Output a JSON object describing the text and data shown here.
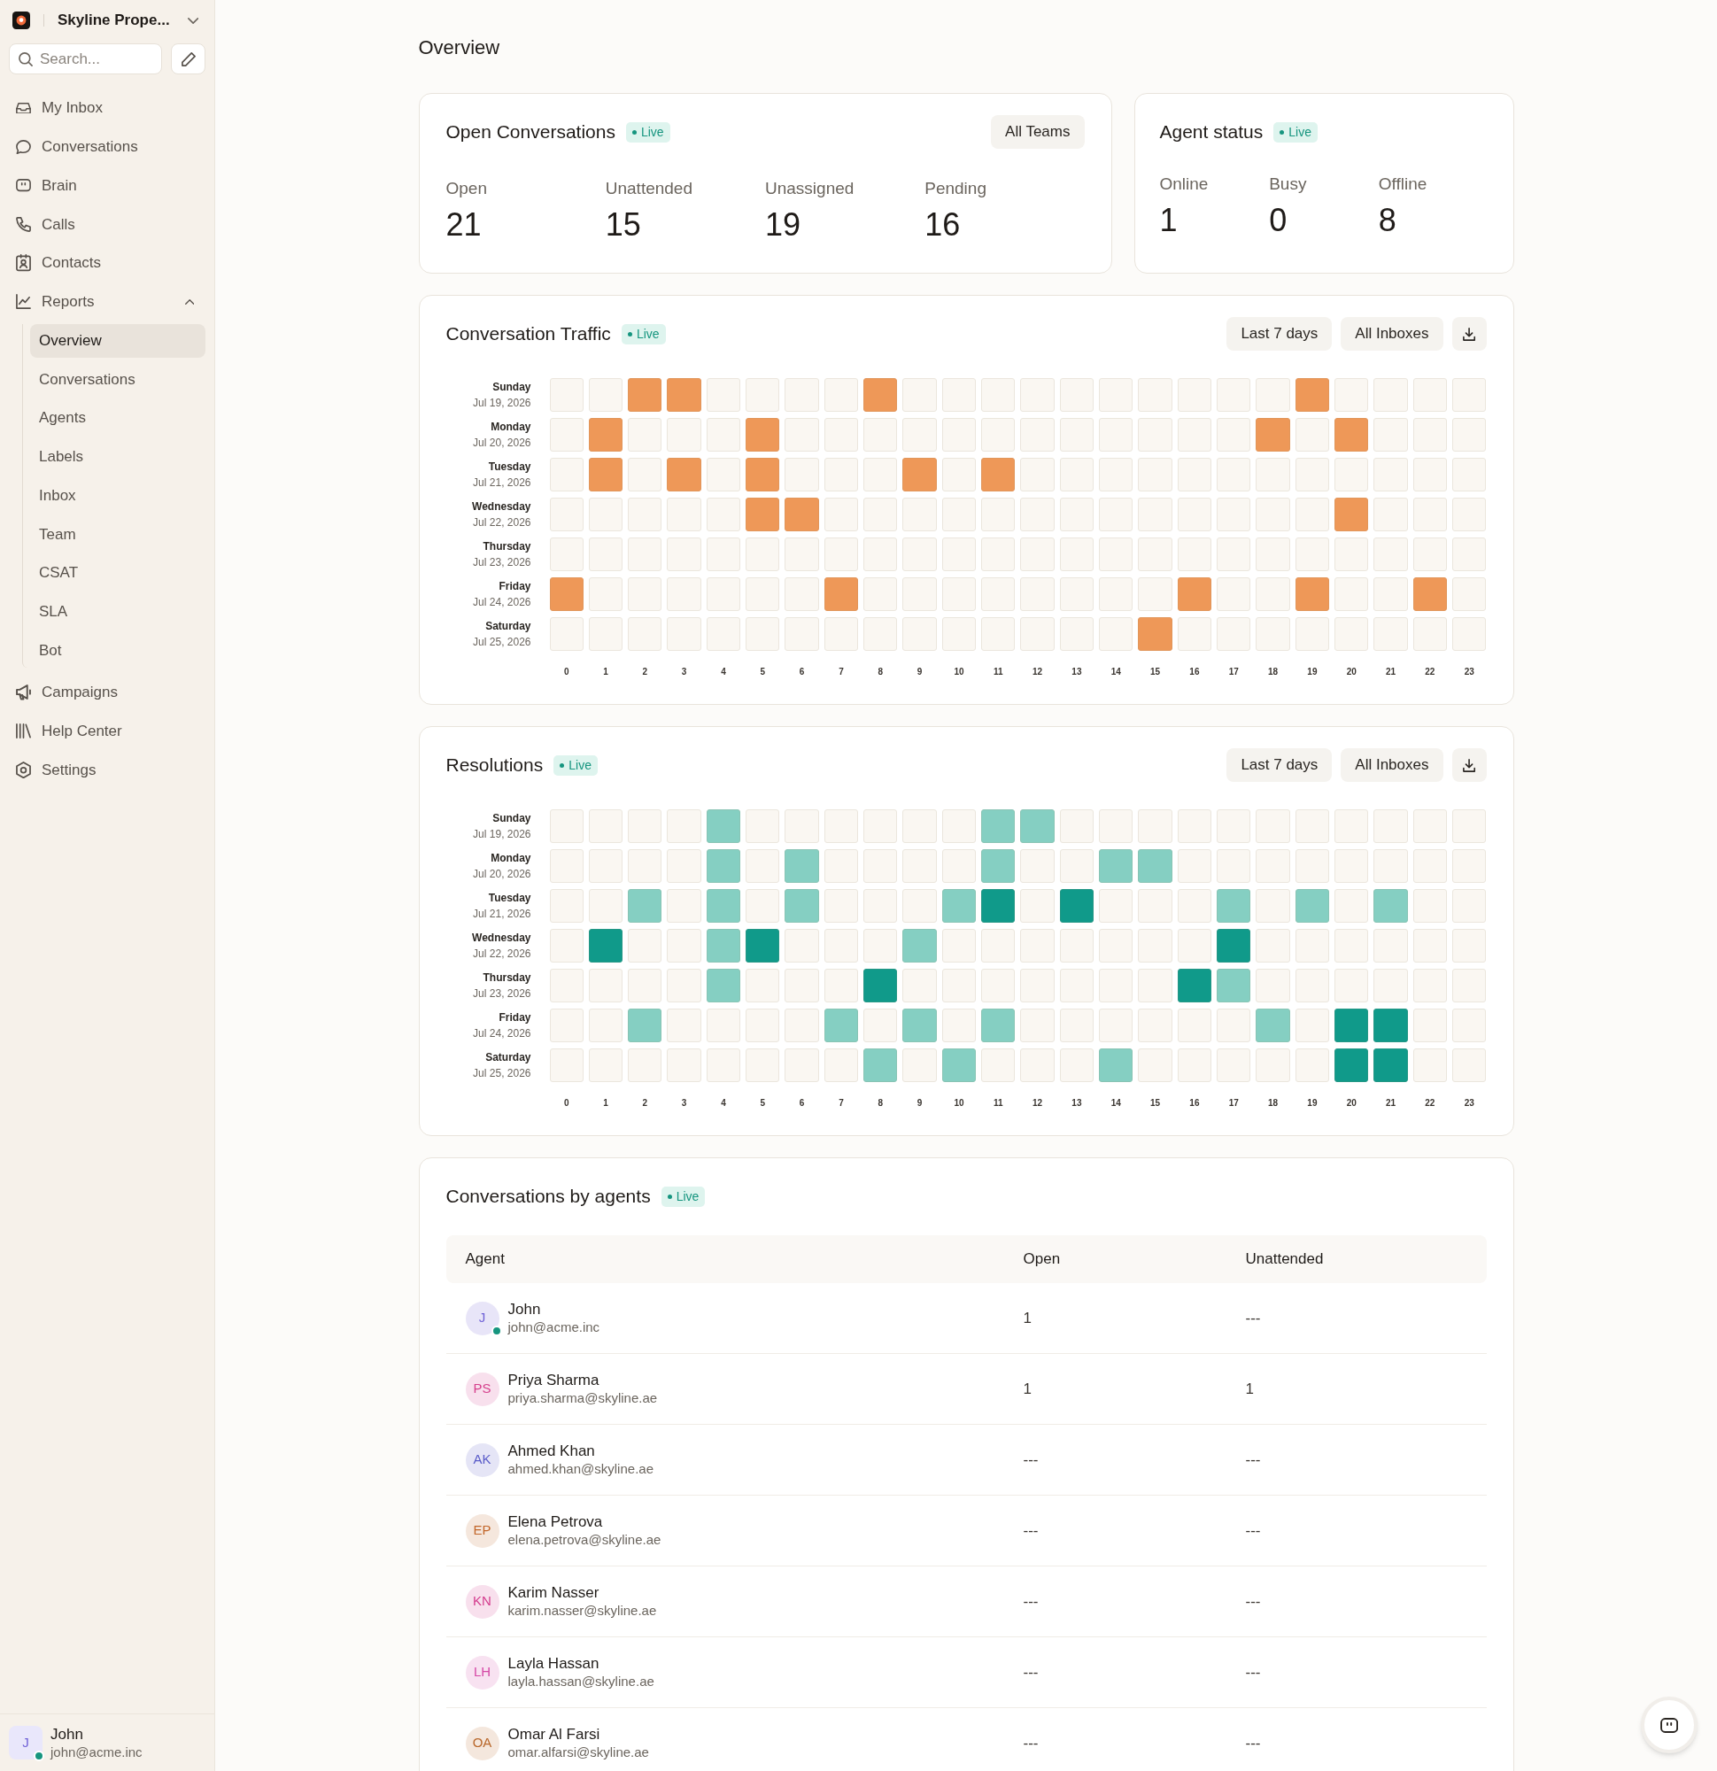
{
  "sidebar": {
    "workspace": {
      "name": "Skyline Prope..."
    },
    "search": {
      "placeholder": "Search..."
    },
    "items": [
      {
        "label": "My Inbox",
        "selected": false
      },
      {
        "label": "Conversations",
        "selected": false
      },
      {
        "label": "Brain",
        "selected": false
      },
      {
        "label": "Calls",
        "selected": false
      },
      {
        "label": "Contacts",
        "selected": false
      },
      {
        "label": "Reports",
        "selected": false,
        "expanded": true,
        "children": [
          {
            "label": "Overview",
            "selected": true
          },
          {
            "label": "Conversations",
            "selected": false
          },
          {
            "label": "Agents",
            "selected": false
          },
          {
            "label": "Labels",
            "selected": false
          },
          {
            "label": "Inbox",
            "selected": false
          },
          {
            "label": "Team",
            "selected": false
          },
          {
            "label": "CSAT",
            "selected": false
          },
          {
            "label": "SLA",
            "selected": false
          },
          {
            "label": "Bot",
            "selected": false
          }
        ]
      },
      {
        "label": "Campaigns",
        "selected": false
      },
      {
        "label": "Help Center",
        "selected": false
      },
      {
        "label": "Settings",
        "selected": false
      }
    ],
    "user": {
      "initials": "J",
      "name": "John",
      "email": "john@acme.inc",
      "online": true
    }
  },
  "page": {
    "title": "Overview"
  },
  "open_conversations": {
    "title": "Open Conversations",
    "badge": "Live",
    "filter": "All Teams",
    "stats": [
      {
        "label": "Open",
        "value": "21"
      },
      {
        "label": "Unattended",
        "value": "15"
      },
      {
        "label": "Unassigned",
        "value": "19"
      },
      {
        "label": "Pending",
        "value": "16"
      }
    ]
  },
  "agent_status": {
    "title": "Agent status",
    "badge": "Live",
    "stats": [
      {
        "label": "Online",
        "value": "1"
      },
      {
        "label": "Busy",
        "value": "0"
      },
      {
        "label": "Offline",
        "value": "8"
      }
    ]
  },
  "conversation_traffic": {
    "title": "Conversation Traffic",
    "badge": "Live",
    "filters": [
      "Last 7 days",
      "All Inboxes"
    ],
    "rows": [
      {
        "day": "Sunday",
        "date": "Jul 19, 2026",
        "cells": [
          {
            "color": "#faf7f2"
          },
          {
            "color": "#faf7f2"
          },
          {
            "color": "#ee9858"
          },
          {
            "color": "#ee9858"
          },
          {
            "color": "#faf7f2"
          },
          {
            "color": "#faf7f2"
          },
          {
            "color": "#faf7f2"
          },
          {
            "color": "#faf7f2"
          },
          {
            "color": "#ee9858"
          },
          {
            "color": "#faf7f2"
          },
          {
            "color": "#faf7f2"
          },
          {
            "color": "#faf7f2"
          },
          {
            "color": "#faf7f2"
          },
          {
            "color": "#faf7f2"
          },
          {
            "color": "#faf7f2"
          },
          {
            "color": "#faf7f2"
          },
          {
            "color": "#faf7f2"
          },
          {
            "color": "#faf7f2"
          },
          {
            "color": "#faf7f2"
          },
          {
            "color": "#ee9858"
          },
          {
            "color": "#faf7f2"
          },
          {
            "color": "#faf7f2"
          },
          {
            "color": "#faf7f2"
          },
          {
            "color": "#faf7f2"
          }
        ]
      },
      {
        "day": "Monday",
        "date": "Jul 20, 2026",
        "cells": [
          {
            "color": "#faf7f2"
          },
          {
            "color": "#ee9858"
          },
          {
            "color": "#faf7f2"
          },
          {
            "color": "#faf7f2"
          },
          {
            "color": "#faf7f2"
          },
          {
            "color": "#ee9858"
          },
          {
            "color": "#faf7f2"
          },
          {
            "color": "#faf7f2"
          },
          {
            "color": "#faf7f2"
          },
          {
            "color": "#faf7f2"
          },
          {
            "color": "#faf7f2"
          },
          {
            "color": "#faf7f2"
          },
          {
            "color": "#faf7f2"
          },
          {
            "color": "#faf7f2"
          },
          {
            "color": "#faf7f2"
          },
          {
            "color": "#faf7f2"
          },
          {
            "color": "#faf7f2"
          },
          {
            "color": "#faf7f2"
          },
          {
            "color": "#ee9858"
          },
          {
            "color": "#faf7f2"
          },
          {
            "color": "#ee9858"
          },
          {
            "color": "#faf7f2"
          },
          {
            "color": "#faf7f2"
          },
          {
            "color": "#faf7f2"
          }
        ]
      },
      {
        "day": "Tuesday",
        "date": "Jul 21, 2026",
        "cells": [
          {
            "color": "#faf7f2"
          },
          {
            "color": "#ee9858"
          },
          {
            "color": "#faf7f2"
          },
          {
            "color": "#ee9858"
          },
          {
            "color": "#faf7f2"
          },
          {
            "color": "#ee9858"
          },
          {
            "color": "#faf7f2"
          },
          {
            "color": "#faf7f2"
          },
          {
            "color": "#faf7f2"
          },
          {
            "color": "#ee9858"
          },
          {
            "color": "#faf7f2"
          },
          {
            "color": "#ee9858"
          },
          {
            "color": "#faf7f2"
          },
          {
            "color": "#faf7f2"
          },
          {
            "color": "#faf7f2"
          },
          {
            "color": "#faf7f2"
          },
          {
            "color": "#faf7f2"
          },
          {
            "color": "#faf7f2"
          },
          {
            "color": "#faf7f2"
          },
          {
            "color": "#faf7f2"
          },
          {
            "color": "#faf7f2"
          },
          {
            "color": "#faf7f2"
          },
          {
            "color": "#faf7f2"
          },
          {
            "color": "#faf7f2"
          }
        ]
      },
      {
        "day": "Wednesday",
        "date": "Jul 22, 2026",
        "cells": [
          {
            "color": "#faf7f2"
          },
          {
            "color": "#faf7f2"
          },
          {
            "color": "#faf7f2"
          },
          {
            "color": "#faf7f2"
          },
          {
            "color": "#faf7f2"
          },
          {
            "color": "#ee9858"
          },
          {
            "color": "#ee9858"
          },
          {
            "color": "#faf7f2"
          },
          {
            "color": "#faf7f2"
          },
          {
            "color": "#faf7f2"
          },
          {
            "color": "#faf7f2"
          },
          {
            "color": "#faf7f2"
          },
          {
            "color": "#faf7f2"
          },
          {
            "color": "#faf7f2"
          },
          {
            "color": "#faf7f2"
          },
          {
            "color": "#faf7f2"
          },
          {
            "color": "#faf7f2"
          },
          {
            "color": "#faf7f2"
          },
          {
            "color": "#faf7f2"
          },
          {
            "color": "#faf7f2"
          },
          {
            "color": "#ee9858"
          },
          {
            "color": "#faf7f2"
          },
          {
            "color": "#faf7f2"
          },
          {
            "color": "#faf7f2"
          }
        ]
      },
      {
        "day": "Thursday",
        "date": "Jul 23, 2026",
        "cells": [
          {
            "color": "#faf7f2"
          },
          {
            "color": "#faf7f2"
          },
          {
            "color": "#faf7f2"
          },
          {
            "color": "#faf7f2"
          },
          {
            "color": "#faf7f2"
          },
          {
            "color": "#faf7f2"
          },
          {
            "color": "#faf7f2"
          },
          {
            "color": "#faf7f2"
          },
          {
            "color": "#faf7f2"
          },
          {
            "color": "#faf7f2"
          },
          {
            "color": "#faf7f2"
          },
          {
            "color": "#faf7f2"
          },
          {
            "color": "#faf7f2"
          },
          {
            "color": "#faf7f2"
          },
          {
            "color": "#faf7f2"
          },
          {
            "color": "#faf7f2"
          },
          {
            "color": "#faf7f2"
          },
          {
            "color": "#faf7f2"
          },
          {
            "color": "#faf7f2"
          },
          {
            "color": "#faf7f2"
          },
          {
            "color": "#faf7f2"
          },
          {
            "color": "#faf7f2"
          },
          {
            "color": "#faf7f2"
          },
          {
            "color": "#faf7f2"
          }
        ]
      },
      {
        "day": "Friday",
        "date": "Jul 24, 2026",
        "cells": [
          {
            "color": "#ee9858"
          },
          {
            "color": "#faf7f2"
          },
          {
            "color": "#faf7f2"
          },
          {
            "color": "#faf7f2"
          },
          {
            "color": "#faf7f2"
          },
          {
            "color": "#faf7f2"
          },
          {
            "color": "#faf7f2"
          },
          {
            "color": "#ee9858"
          },
          {
            "color": "#faf7f2"
          },
          {
            "color": "#faf7f2"
          },
          {
            "color": "#faf7f2"
          },
          {
            "color": "#faf7f2"
          },
          {
            "color": "#faf7f2"
          },
          {
            "color": "#faf7f2"
          },
          {
            "color": "#faf7f2"
          },
          {
            "color": "#faf7f2"
          },
          {
            "color": "#ee9858"
          },
          {
            "color": "#faf7f2"
          },
          {
            "color": "#faf7f2"
          },
          {
            "color": "#ee9858"
          },
          {
            "color": "#faf7f2"
          },
          {
            "color": "#faf7f2"
          },
          {
            "color": "#ee9858"
          },
          {
            "color": "#faf7f2"
          }
        ]
      },
      {
        "day": "Saturday",
        "date": "Jul 25, 2026",
        "cells": [
          {
            "color": "#faf7f2"
          },
          {
            "color": "#faf7f2"
          },
          {
            "color": "#faf7f2"
          },
          {
            "color": "#faf7f2"
          },
          {
            "color": "#faf7f2"
          },
          {
            "color": "#faf7f2"
          },
          {
            "color": "#faf7f2"
          },
          {
            "color": "#faf7f2"
          },
          {
            "color": "#faf7f2"
          },
          {
            "color": "#faf7f2"
          },
          {
            "color": "#faf7f2"
          },
          {
            "color": "#faf7f2"
          },
          {
            "color": "#faf7f2"
          },
          {
            "color": "#faf7f2"
          },
          {
            "color": "#faf7f2"
          },
          {
            "color": "#ee9858"
          },
          {
            "color": "#faf7f2"
          },
          {
            "color": "#faf7f2"
          },
          {
            "color": "#faf7f2"
          },
          {
            "color": "#faf7f2"
          },
          {
            "color": "#faf7f2"
          },
          {
            "color": "#faf7f2"
          },
          {
            "color": "#faf7f2"
          },
          {
            "color": "#faf7f2"
          }
        ]
      }
    ],
    "hours": [
      "0",
      "1",
      "2",
      "3",
      "4",
      "5",
      "6",
      "7",
      "8",
      "9",
      "10",
      "11",
      "12",
      "13",
      "14",
      "15",
      "16",
      "17",
      "18",
      "19",
      "20",
      "21",
      "22",
      "23"
    ]
  },
  "resolutions": {
    "title": "Resolutions",
    "badge": "Live",
    "filters": [
      "Last 7 days",
      "All Inboxes"
    ],
    "rows": [
      {
        "day": "Sunday",
        "date": "Jul 19, 2026",
        "cells": [
          {
            "color": "#faf7f2"
          },
          {
            "color": "#faf7f2"
          },
          {
            "color": "#faf7f2"
          },
          {
            "color": "#faf7f2"
          },
          {
            "color": "#85cfc2"
          },
          {
            "color": "#faf7f2"
          },
          {
            "color": "#faf7f2"
          },
          {
            "color": "#faf7f2"
          },
          {
            "color": "#faf7f2"
          },
          {
            "color": "#faf7f2"
          },
          {
            "color": "#faf7f2"
          },
          {
            "color": "#85cfc2"
          },
          {
            "color": "#85cfc2"
          },
          {
            "color": "#faf7f2"
          },
          {
            "color": "#faf7f2"
          },
          {
            "color": "#faf7f2"
          },
          {
            "color": "#faf7f2"
          },
          {
            "color": "#faf7f2"
          },
          {
            "color": "#faf7f2"
          },
          {
            "color": "#faf7f2"
          },
          {
            "color": "#faf7f2"
          },
          {
            "color": "#faf7f2"
          },
          {
            "color": "#faf7f2"
          },
          {
            "color": "#faf7f2"
          }
        ]
      },
      {
        "day": "Monday",
        "date": "Jul 20, 2026",
        "cells": [
          {
            "color": "#faf7f2"
          },
          {
            "color": "#faf7f2"
          },
          {
            "color": "#faf7f2"
          },
          {
            "color": "#faf7f2"
          },
          {
            "color": "#85cfc2"
          },
          {
            "color": "#faf7f2"
          },
          {
            "color": "#85cfc2"
          },
          {
            "color": "#faf7f2"
          },
          {
            "color": "#faf7f2"
          },
          {
            "color": "#faf7f2"
          },
          {
            "color": "#faf7f2"
          },
          {
            "color": "#85cfc2"
          },
          {
            "color": "#faf7f2"
          },
          {
            "color": "#faf7f2"
          },
          {
            "color": "#85cfc2"
          },
          {
            "color": "#85cfc2"
          },
          {
            "color": "#faf7f2"
          },
          {
            "color": "#faf7f2"
          },
          {
            "color": "#faf7f2"
          },
          {
            "color": "#faf7f2"
          },
          {
            "color": "#faf7f2"
          },
          {
            "color": "#faf7f2"
          },
          {
            "color": "#faf7f2"
          },
          {
            "color": "#faf7f2"
          }
        ]
      },
      {
        "day": "Tuesday",
        "date": "Jul 21, 2026",
        "cells": [
          {
            "color": "#faf7f2"
          },
          {
            "color": "#faf7f2"
          },
          {
            "color": "#85cfc2"
          },
          {
            "color": "#faf7f2"
          },
          {
            "color": "#85cfc2"
          },
          {
            "color": "#faf7f2"
          },
          {
            "color": "#85cfc2"
          },
          {
            "color": "#faf7f2"
          },
          {
            "color": "#faf7f2"
          },
          {
            "color": "#faf7f2"
          },
          {
            "color": "#85cfc2"
          },
          {
            "color": "#109a8a"
          },
          {
            "color": "#faf7f2"
          },
          {
            "color": "#109a8a"
          },
          {
            "color": "#faf7f2"
          },
          {
            "color": "#faf7f2"
          },
          {
            "color": "#faf7f2"
          },
          {
            "color": "#85cfc2"
          },
          {
            "color": "#faf7f2"
          },
          {
            "color": "#85cfc2"
          },
          {
            "color": "#faf7f2"
          },
          {
            "color": "#85cfc2"
          },
          {
            "color": "#faf7f2"
          },
          {
            "color": "#faf7f2"
          }
        ]
      },
      {
        "day": "Wednesday",
        "date": "Jul 22, 2026",
        "cells": [
          {
            "color": "#faf7f2"
          },
          {
            "color": "#109a8a"
          },
          {
            "color": "#faf7f2"
          },
          {
            "color": "#faf7f2"
          },
          {
            "color": "#85cfc2"
          },
          {
            "color": "#109a8a"
          },
          {
            "color": "#faf7f2"
          },
          {
            "color": "#faf7f2"
          },
          {
            "color": "#faf7f2"
          },
          {
            "color": "#85cfc2"
          },
          {
            "color": "#faf7f2"
          },
          {
            "color": "#faf7f2"
          },
          {
            "color": "#faf7f2"
          },
          {
            "color": "#faf7f2"
          },
          {
            "color": "#faf7f2"
          },
          {
            "color": "#faf7f2"
          },
          {
            "color": "#faf7f2"
          },
          {
            "color": "#109a8a"
          },
          {
            "color": "#faf7f2"
          },
          {
            "color": "#faf7f2"
          },
          {
            "color": "#faf7f2"
          },
          {
            "color": "#faf7f2"
          },
          {
            "color": "#faf7f2"
          },
          {
            "color": "#faf7f2"
          }
        ]
      },
      {
        "day": "Thursday",
        "date": "Jul 23, 2026",
        "cells": [
          {
            "color": "#faf7f2"
          },
          {
            "color": "#faf7f2"
          },
          {
            "color": "#faf7f2"
          },
          {
            "color": "#faf7f2"
          },
          {
            "color": "#85cfc2"
          },
          {
            "color": "#faf7f2"
          },
          {
            "color": "#faf7f2"
          },
          {
            "color": "#faf7f2"
          },
          {
            "color": "#109a8a"
          },
          {
            "color": "#faf7f2"
          },
          {
            "color": "#faf7f2"
          },
          {
            "color": "#faf7f2"
          },
          {
            "color": "#faf7f2"
          },
          {
            "color": "#faf7f2"
          },
          {
            "color": "#faf7f2"
          },
          {
            "color": "#faf7f2"
          },
          {
            "color": "#109a8a"
          },
          {
            "color": "#85cfc2"
          },
          {
            "color": "#faf7f2"
          },
          {
            "color": "#faf7f2"
          },
          {
            "color": "#faf7f2"
          },
          {
            "color": "#faf7f2"
          },
          {
            "color": "#faf7f2"
          },
          {
            "color": "#faf7f2"
          }
        ]
      },
      {
        "day": "Friday",
        "date": "Jul 24, 2026",
        "cells": [
          {
            "color": "#faf7f2"
          },
          {
            "color": "#faf7f2"
          },
          {
            "color": "#85cfc2"
          },
          {
            "color": "#faf7f2"
          },
          {
            "color": "#faf7f2"
          },
          {
            "color": "#faf7f2"
          },
          {
            "color": "#faf7f2"
          },
          {
            "color": "#85cfc2"
          },
          {
            "color": "#faf7f2"
          },
          {
            "color": "#85cfc2"
          },
          {
            "color": "#faf7f2"
          },
          {
            "color": "#85cfc2"
          },
          {
            "color": "#faf7f2"
          },
          {
            "color": "#faf7f2"
          },
          {
            "color": "#faf7f2"
          },
          {
            "color": "#faf7f2"
          },
          {
            "color": "#faf7f2"
          },
          {
            "color": "#faf7f2"
          },
          {
            "color": "#85cfc2"
          },
          {
            "color": "#faf7f2"
          },
          {
            "color": "#109a8a"
          },
          {
            "color": "#109a8a"
          },
          {
            "color": "#faf7f2"
          },
          {
            "color": "#faf7f2"
          }
        ]
      },
      {
        "day": "Saturday",
        "date": "Jul 25, 2026",
        "cells": [
          {
            "color": "#faf7f2"
          },
          {
            "color": "#faf7f2"
          },
          {
            "color": "#faf7f2"
          },
          {
            "color": "#faf7f2"
          },
          {
            "color": "#faf7f2"
          },
          {
            "color": "#faf7f2"
          },
          {
            "color": "#faf7f2"
          },
          {
            "color": "#faf7f2"
          },
          {
            "color": "#85cfc2"
          },
          {
            "color": "#faf7f2"
          },
          {
            "color": "#85cfc2"
          },
          {
            "color": "#faf7f2"
          },
          {
            "color": "#faf7f2"
          },
          {
            "color": "#faf7f2"
          },
          {
            "color": "#85cfc2"
          },
          {
            "color": "#faf7f2"
          },
          {
            "color": "#faf7f2"
          },
          {
            "color": "#faf7f2"
          },
          {
            "color": "#faf7f2"
          },
          {
            "color": "#faf7f2"
          },
          {
            "color": "#109a8a"
          },
          {
            "color": "#109a8a"
          },
          {
            "color": "#faf7f2"
          },
          {
            "color": "#faf7f2"
          }
        ]
      }
    ],
    "hours": [
      "0",
      "1",
      "2",
      "3",
      "4",
      "5",
      "6",
      "7",
      "8",
      "9",
      "10",
      "11",
      "12",
      "13",
      "14",
      "15",
      "16",
      "17",
      "18",
      "19",
      "20",
      "21",
      "22",
      "23"
    ]
  },
  "conversations_by_agents": {
    "title": "Conversations by agents",
    "badge": "Live",
    "columns": [
      "Agent",
      "Open",
      "Unattended"
    ],
    "rows": [
      {
        "initials": "J",
        "color": "#6d5fd6",
        "name": "John",
        "email": "john@acme.inc",
        "online": true,
        "open": "1",
        "unattended": "---"
      },
      {
        "initials": "PS",
        "color": "#d63f8c",
        "name": "Priya Sharma",
        "email": "priya.sharma@skyline.ae",
        "online": false,
        "open": "1",
        "unattended": "1"
      },
      {
        "initials": "AK",
        "color": "#5a5cc9",
        "name": "Ahmed Khan",
        "email": "ahmed.khan@skyline.ae",
        "online": false,
        "open": "---",
        "unattended": "---"
      },
      {
        "initials": "EP",
        "color": "#c2662a",
        "name": "Elena Petrova",
        "email": "elena.petrova@skyline.ae",
        "online": false,
        "open": "---",
        "unattended": "---"
      },
      {
        "initials": "KN",
        "color": "#d43c8e",
        "name": "Karim Nasser",
        "email": "karim.nasser@skyline.ae",
        "online": false,
        "open": "---",
        "unattended": "---"
      },
      {
        "initials": "LH",
        "color": "#d548a6",
        "name": "Layla Hassan",
        "email": "layla.hassan@skyline.ae",
        "online": false,
        "open": "---",
        "unattended": "---"
      },
      {
        "initials": "OA",
        "color": "#b9682c",
        "name": "Omar Al Farsi",
        "email": "omar.alfarsi@skyline.ae",
        "online": false,
        "open": "---",
        "unattended": "---"
      }
    ]
  }
}
